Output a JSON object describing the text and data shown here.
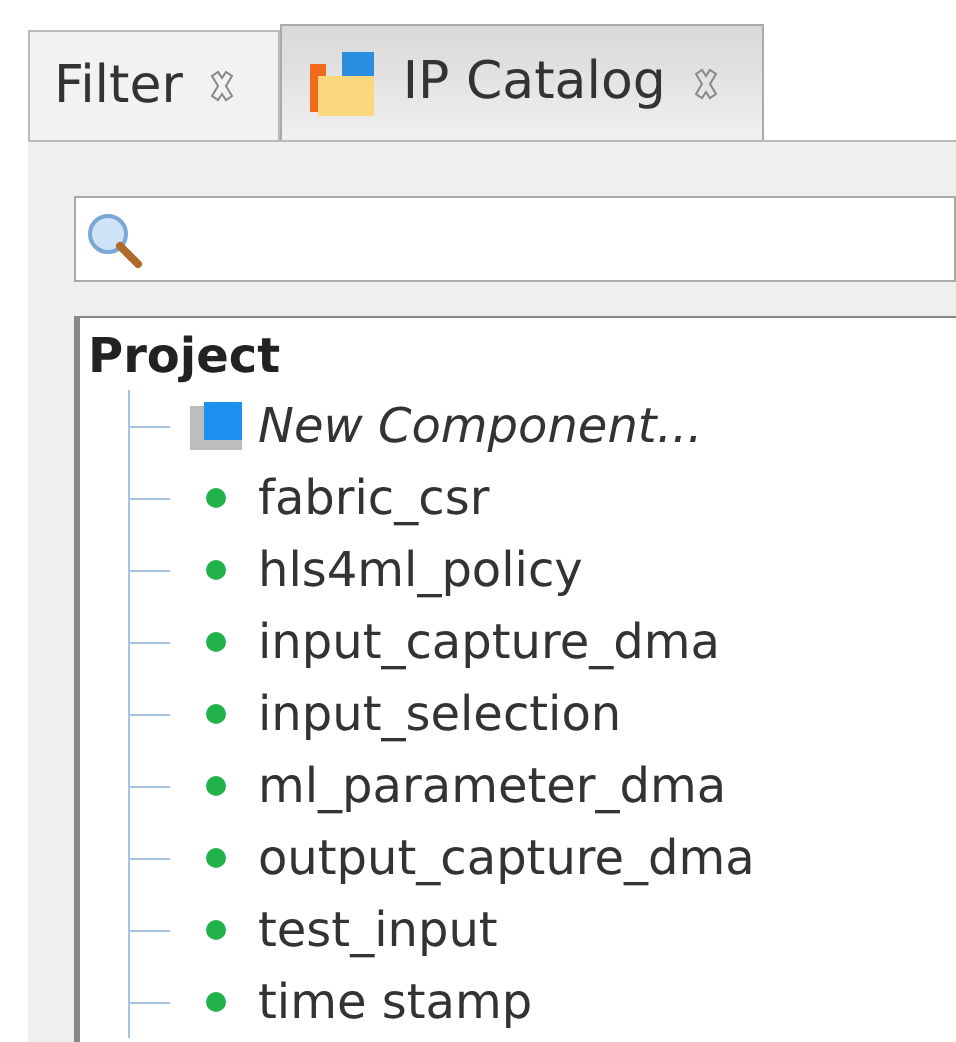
{
  "tabs": [
    {
      "label": "Filter",
      "selected": false,
      "icon": false
    },
    {
      "label": "IP Catalog",
      "selected": true,
      "icon": true
    }
  ],
  "tree": {
    "label": "Project",
    "children": [
      {
        "label": "New Component...",
        "kind": "new"
      },
      {
        "label": "fabric_csr",
        "kind": "component"
      },
      {
        "label": "hls4ml_policy",
        "kind": "component"
      },
      {
        "label": "input_capture_dma",
        "kind": "component"
      },
      {
        "label": "input_selection",
        "kind": "component"
      },
      {
        "label": "ml_parameter_dma",
        "kind": "component"
      },
      {
        "label": "output_capture_dma",
        "kind": "component"
      },
      {
        "label": "test_input",
        "kind": "component"
      },
      {
        "label": "time stamp",
        "kind": "component"
      }
    ]
  }
}
